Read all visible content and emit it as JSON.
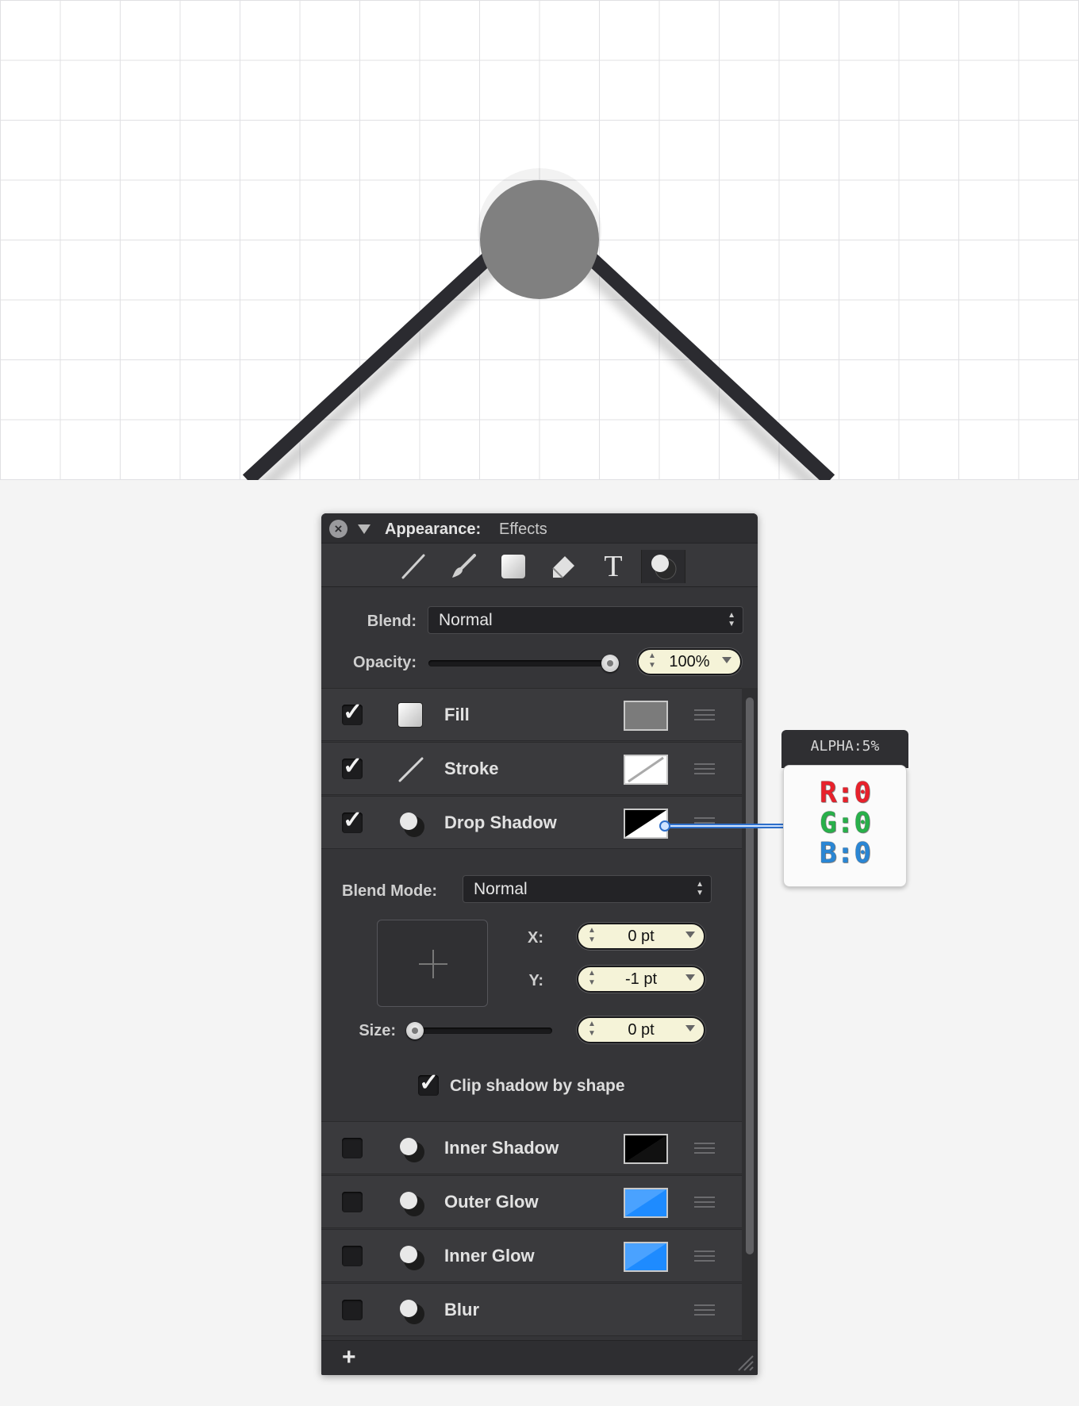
{
  "panel": {
    "title": "Appearance:",
    "subtitle": "Effects",
    "tools": [
      "stroke-tool-icon",
      "brush-tool-icon",
      "fill-tool-icon",
      "eraser-tool-icon",
      "text-tool-icon",
      "effects-tool-icon"
    ],
    "active_tool": "effects-tool-icon",
    "blend_label": "Blend:",
    "blend_value": "Normal",
    "opacity_label": "Opacity:",
    "opacity_value": "100%",
    "opacity_level": 1.0
  },
  "effects": [
    {
      "label": "Fill",
      "checked": true,
      "swatch": "gray",
      "color": "#7b7b7b"
    },
    {
      "label": "Stroke",
      "checked": true,
      "swatch": "stroke"
    },
    {
      "label": "Drop Shadow",
      "checked": true,
      "swatch": "black-white"
    },
    {
      "label": "Inner Shadow",
      "checked": false,
      "swatch": "black"
    },
    {
      "label": "Outer Glow",
      "checked": false,
      "swatch": "blue",
      "color": "#1e8bff"
    },
    {
      "label": "Inner Glow",
      "checked": false,
      "swatch": "blue",
      "color": "#1e8bff"
    },
    {
      "label": "Blur",
      "checked": false,
      "swatch": "none"
    }
  ],
  "drop_shadow": {
    "blend_mode_label": "Blend Mode:",
    "blend_mode_value": "Normal",
    "x_label": "X:",
    "x_value": "0 pt",
    "y_label": "Y:",
    "y_value": "-1 pt",
    "size_label": "Size:",
    "size_value": "0 pt",
    "size_level": 0,
    "clip_label": "Clip shadow by shape",
    "clip_checked": true
  },
  "footer": {
    "add_label": "+"
  },
  "tooltip": {
    "alpha": "ALPHA:5%",
    "r": "R:0",
    "g": "G:0",
    "b": "B:0",
    "r_color": "#e8212b",
    "g_color": "#28b04a",
    "b_color": "#2a86d4"
  },
  "colors": {
    "line": "#2b2b30",
    "node": "#808080",
    "panel_bg": "#353538",
    "field_bg": "#f5f3d8"
  }
}
